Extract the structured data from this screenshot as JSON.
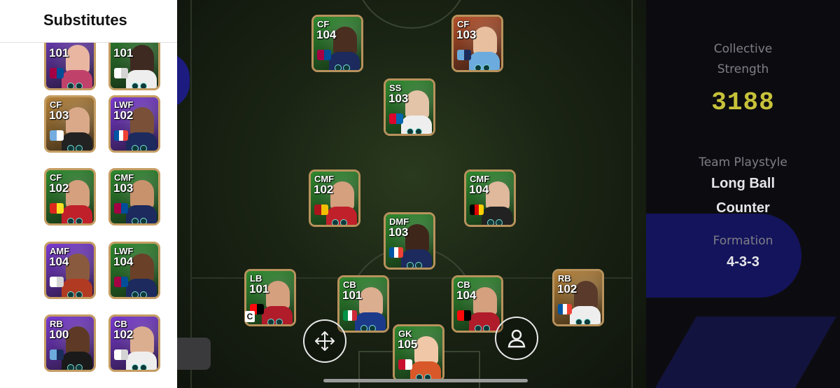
{
  "sidebar": {
    "title": "Substitutes",
    "cards": [
      {
        "pos": "",
        "ovr": "101",
        "bg": "#6b3bb5",
        "border": "#c59d62",
        "skin": "#e9b6a2",
        "kit": "#c0426b",
        "badge": "barcelona-badge",
        "badge_colors": [
          "#a50044",
          "#004d98"
        ]
      },
      {
        "pos": "",
        "ovr": "101",
        "bg": "#2d7a2d",
        "border": "#c59d62",
        "skin": "#3e2a20",
        "kit": "#eeeeee",
        "badge": "real-madrid-badge",
        "badge_colors": [
          "#ffffff",
          "#d4d4d4"
        ]
      },
      {
        "pos": "CF",
        "ovr": "103",
        "bg": "#b5823a",
        "border": "#c59d62",
        "skin": "#d9a98a",
        "kit": "#222222",
        "badge": "argentina-flag",
        "badge_colors": [
          "#74acdf",
          "#ffffff"
        ]
      },
      {
        "pos": "LWF",
        "ovr": "102",
        "bg": "#7a3bd1",
        "border": "#c59d62",
        "skin": "#7a5038",
        "kit": "#1c2a5e",
        "badge": "france-flag",
        "badge_colors": [
          "#0055a4",
          "#ffffff",
          "#ef4135"
        ]
      },
      {
        "pos": "CF",
        "ovr": "102",
        "bg": "#2f8a2f",
        "border": "#c59d62",
        "skin": "#d4a07e",
        "kit": "#c0202a",
        "badge": "man-united-badge",
        "badge_colors": [
          "#da291c",
          "#fbe122"
        ]
      },
      {
        "pos": "CMF",
        "ovr": "103",
        "bg": "#2f8a2f",
        "border": "#c59d62",
        "skin": "#c8926c",
        "kit": "#1c2a5e",
        "badge": "barcelona-badge",
        "badge_colors": [
          "#a50044",
          "#004d98"
        ]
      },
      {
        "pos": "AMF",
        "ovr": "104",
        "bg": "#7a3bd1",
        "border": "#c59d62",
        "skin": "#8a5a3e",
        "kit": "#b13a22",
        "badge": "real-madrid-badge",
        "badge_colors": [
          "#ffffff",
          "#d4d4d4"
        ]
      },
      {
        "pos": "LWF",
        "ovr": "104",
        "bg": "#2f8a2f",
        "border": "#c59d62",
        "skin": "#6a4028",
        "kit": "#1c2a5e",
        "badge": "barcelona-badge",
        "badge_colors": [
          "#a50044",
          "#004d98"
        ]
      },
      {
        "pos": "RB",
        "ovr": "100",
        "bg": "#7a3bd1",
        "border": "#c59d62",
        "skin": "#5e3a26",
        "kit": "#1a1a1a",
        "badge": "man-city-badge",
        "badge_colors": [
          "#6cabdd",
          "#1c2c5b"
        ]
      },
      {
        "pos": "CB",
        "ovr": "102",
        "bg": "#7a3bd1",
        "border": "#c59d62",
        "skin": "#dcae90",
        "kit": "#eeeeee",
        "badge": "real-madrid-badge",
        "badge_colors": [
          "#ffffff",
          "#d4d4d4"
        ]
      }
    ]
  },
  "pitch": {
    "players": [
      {
        "pos": "CF",
        "ovr": "104",
        "bg": "#2f8a2f",
        "skin": "#4a2e20",
        "kit": "#1c2a5e",
        "badge": "barcelona-badge",
        "badge_colors": [
          "#a50044",
          "#004d98"
        ]
      },
      {
        "pos": "CF",
        "ovr": "103",
        "bg": "#b5502a",
        "skin": "#e8c0a0",
        "kit": "#6cabdd",
        "badge": "man-city-badge",
        "badge_colors": [
          "#6cabdd",
          "#1c2c5b"
        ]
      },
      {
        "pos": "SS",
        "ovr": "103",
        "bg": "#2f8a2f",
        "skin": "#e4c4a8",
        "kit": "#eeeeee",
        "badge": "bayern-badge",
        "badge_colors": [
          "#dc052d",
          "#0066b2"
        ]
      },
      {
        "pos": "CMF",
        "ovr": "102",
        "bg": "#2f8a2f",
        "skin": "#d4a07e",
        "kit": "#c0202a",
        "badge": "spain-flag",
        "badge_colors": [
          "#aa151b",
          "#f1bf00"
        ]
      },
      {
        "pos": "CMF",
        "ovr": "104",
        "bg": "#2f8a2f",
        "skin": "#e0b89c",
        "kit": "#222222",
        "badge": "germany-flag",
        "badge_colors": [
          "#000000",
          "#dd0000",
          "#ffce00"
        ]
      },
      {
        "pos": "DMF",
        "ovr": "103",
        "bg": "#2f8a2f",
        "skin": "#3e261a",
        "kit": "#1c2a5e",
        "badge": "france-flag",
        "badge_colors": [
          "#0055a4",
          "#ffffff",
          "#ef4135"
        ]
      },
      {
        "pos": "LB",
        "ovr": "101",
        "bg": "#2f8a2f",
        "skin": "#d4a07e",
        "kit": "#b01c2a",
        "badge": "ac-milan-badge",
        "badge_colors": [
          "#fb090b",
          "#000000"
        ]
      },
      {
        "pos": "CB",
        "ovr": "101",
        "bg": "#2f8a2f",
        "skin": "#dcae90",
        "kit": "#1c3a8a",
        "badge": "italy-flag",
        "badge_colors": [
          "#009246",
          "#ffffff",
          "#ce2b37"
        ]
      },
      {
        "pos": "CB",
        "ovr": "104",
        "bg": "#2f8a2f",
        "skin": "#d4a07e",
        "kit": "#b01c2a",
        "badge": "ac-milan-badge",
        "badge_colors": [
          "#fb090b",
          "#000000"
        ]
      },
      {
        "pos": "RB",
        "ovr": "102",
        "bg": "#b5823a",
        "skin": "#5a3a2a",
        "kit": "#eeeeee",
        "badge": "france-flag",
        "badge_colors": [
          "#0055a4",
          "#ffffff",
          "#ef4135"
        ]
      },
      {
        "pos": "GK",
        "ovr": "105",
        "bg": "#2f8a2f",
        "skin": "#f0c8a8",
        "kit": "#d8582a",
        "badge": "denmark-flag",
        "badge_colors": [
          "#c8102e",
          "#ffffff"
        ]
      }
    ],
    "captain_tag": "C"
  },
  "controls": {
    "move_icon": "move-arrows-icon",
    "profile_icon": "person-icon"
  },
  "summary": {
    "collective_label_1": "Collective",
    "collective_label_2": "Strength",
    "collective_value": "3188",
    "playstyle_label": "Team Playstyle",
    "playstyle_value_1": "Long Ball",
    "playstyle_value_2": "Counter",
    "formation_label": "Formation",
    "formation_value": "4-3-3"
  },
  "colors": {
    "strength_accent": "#c7c23a",
    "card_border": "#c59d62",
    "pitch_green": "#1a2414"
  }
}
